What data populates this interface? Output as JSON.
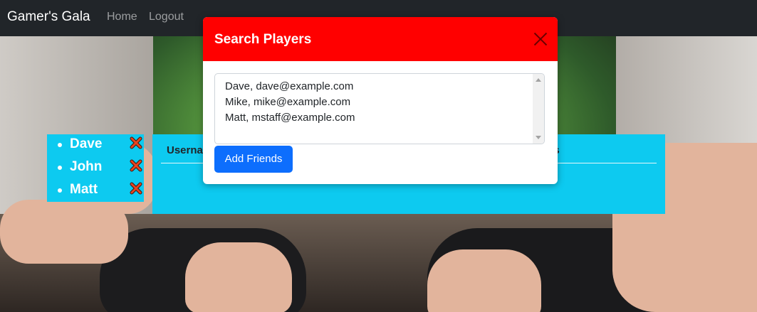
{
  "navbar": {
    "brand": "Gamer's Gala",
    "links": [
      {
        "label": "Home"
      },
      {
        "label": "Logout"
      }
    ]
  },
  "friends": {
    "items": [
      {
        "name": "Dave"
      },
      {
        "name": "John"
      },
      {
        "name": "Matt"
      }
    ],
    "remove_icon": "close-x-icon",
    "remove_icon_color": "#e8431f"
  },
  "players_table": {
    "headers": [
      "Userna",
      "lers"
    ]
  },
  "modal": {
    "title": "Search Players",
    "close_icon": "close-icon",
    "textarea_lines": [
      "Dave, dave@example.com",
      "Mike, mike@example.com",
      "Matt, mstaff@example.com"
    ],
    "add_button_label": "Add Friends"
  },
  "colors": {
    "navbar_bg": "#212529",
    "modal_header_bg": "#ff0000",
    "panel_bg": "#0dcaf0",
    "primary_button": "#0d6efd"
  }
}
